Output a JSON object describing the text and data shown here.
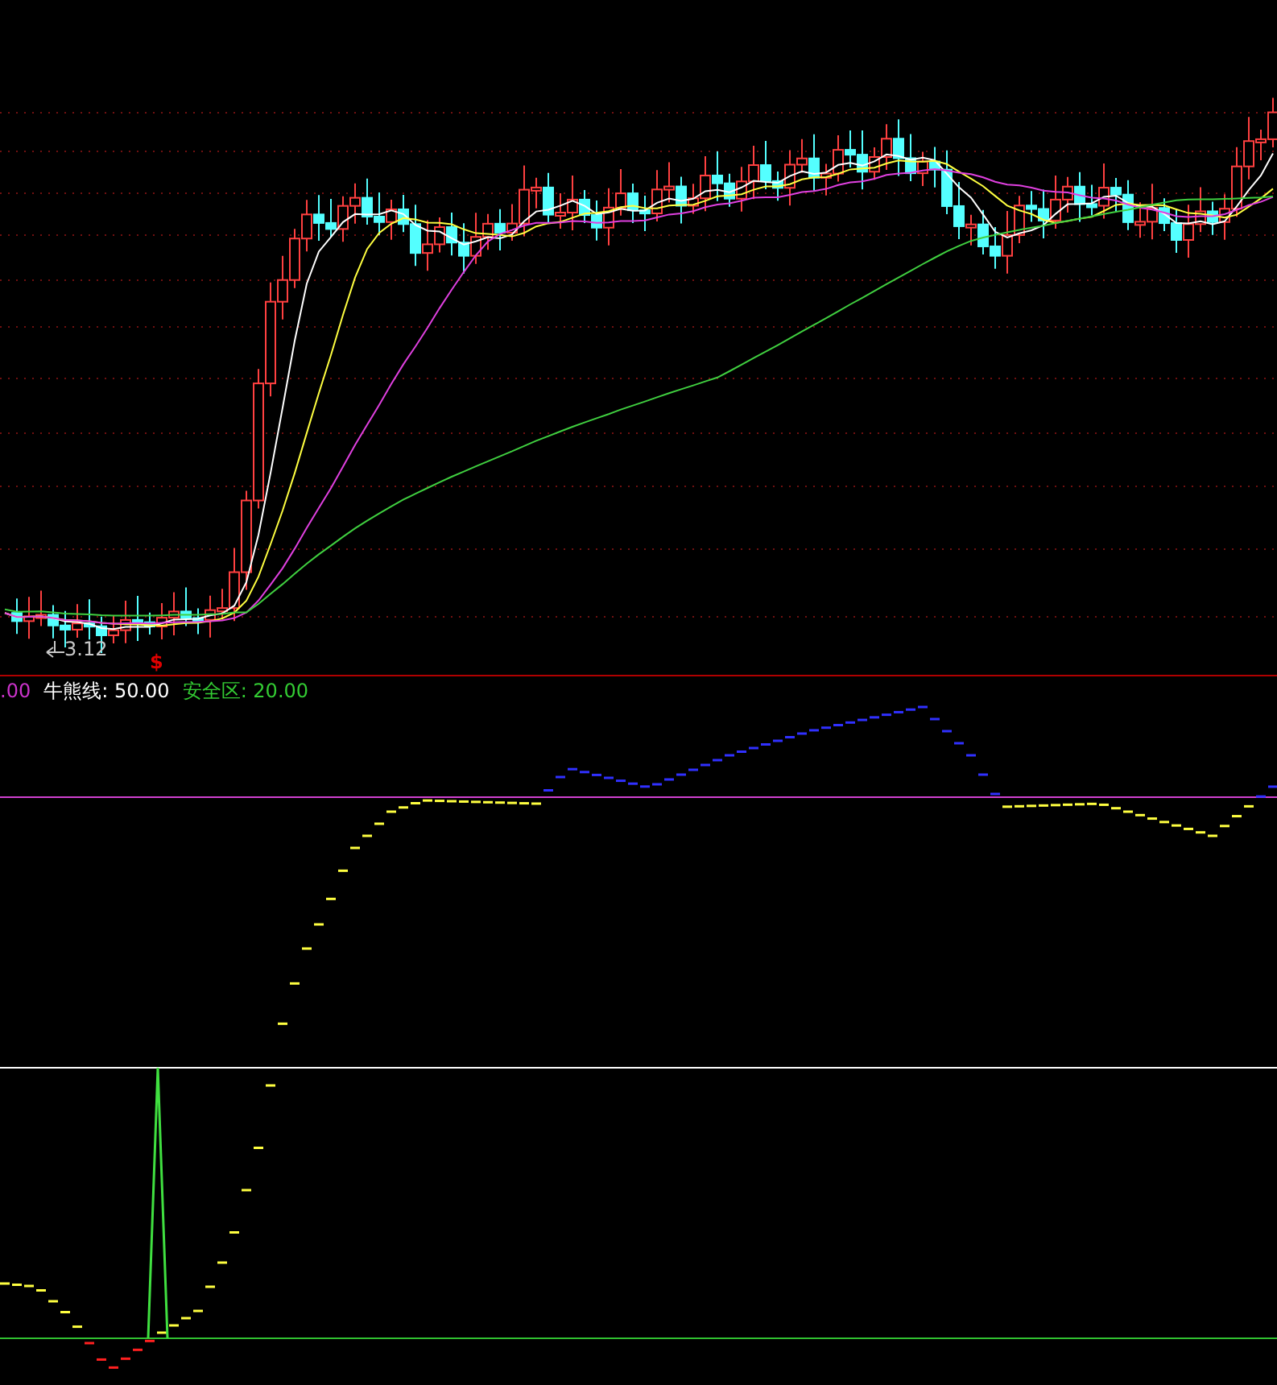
{
  "price_panel": {
    "low_marker": "3.12",
    "signal_marker": "$"
  },
  "indicator_panel": {
    "legend": [
      {
        "label": ".00",
        "color": "#cc33cc"
      },
      {
        "label": "牛熊线: 50.00",
        "color": "#ffffff"
      },
      {
        "label": "安全区: 20.00",
        "color": "#33cc33"
      }
    ]
  }
}
